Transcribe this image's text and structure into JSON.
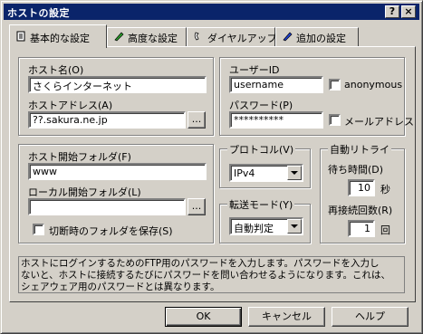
{
  "window": {
    "title": "ホストの設定",
    "help_btn": "?",
    "close_btn": "×"
  },
  "tabs": [
    {
      "label": "基本的な設定",
      "icon": "document-icon"
    },
    {
      "label": "高度な設定",
      "icon": "pen-check-icon"
    },
    {
      "label": "ダイヤルアップ",
      "icon": "phone-icon"
    },
    {
      "label": "追加の設定",
      "icon": "pen-icon"
    }
  ],
  "host": {
    "name_label": "ホスト名(O)",
    "name_value": "さくらインターネット",
    "address_label": "ホストアドレス(A)",
    "address_value": "??.sakura.ne.jp",
    "browse": "..."
  },
  "user": {
    "id_label": "ユーザーID",
    "id_value": "username",
    "anonymous": "anonymous",
    "password_label": "パスワード(P)",
    "password_value": "**********",
    "mail_address": "メールアドレス"
  },
  "folders": {
    "host_label": "ホスト開始フォルダ(F)",
    "host_value": "www",
    "local_label": "ローカル開始フォルダ(L)",
    "local_value": "",
    "browse": "...",
    "save_on_disconnect": "切断時のフォルダを保存(S)"
  },
  "protocol": {
    "label": "プロトコル(V)",
    "value": "IPv4"
  },
  "transfer": {
    "label": "転送モード(Y)",
    "value": "自動判定"
  },
  "retry": {
    "label": "自動リトライ",
    "wait_label": "待ち時間(D)",
    "wait_value": "10",
    "wait_unit": "秒",
    "count_label": "再接続回数(R)",
    "count_value": "1",
    "count_unit": "回"
  },
  "info": {
    "line1": "ホストにログインするためのFTP用のパスワードを入力します。パスワードを入力し",
    "line2": "ないと、ホストに接続するたびにパスワードを問い合わせるようになります。これは、",
    "line3": "シェアウェア用のパスワードとは異なります。"
  },
  "buttons": {
    "ok": "OK",
    "cancel": "キャンセル",
    "help": "ヘルプ"
  }
}
